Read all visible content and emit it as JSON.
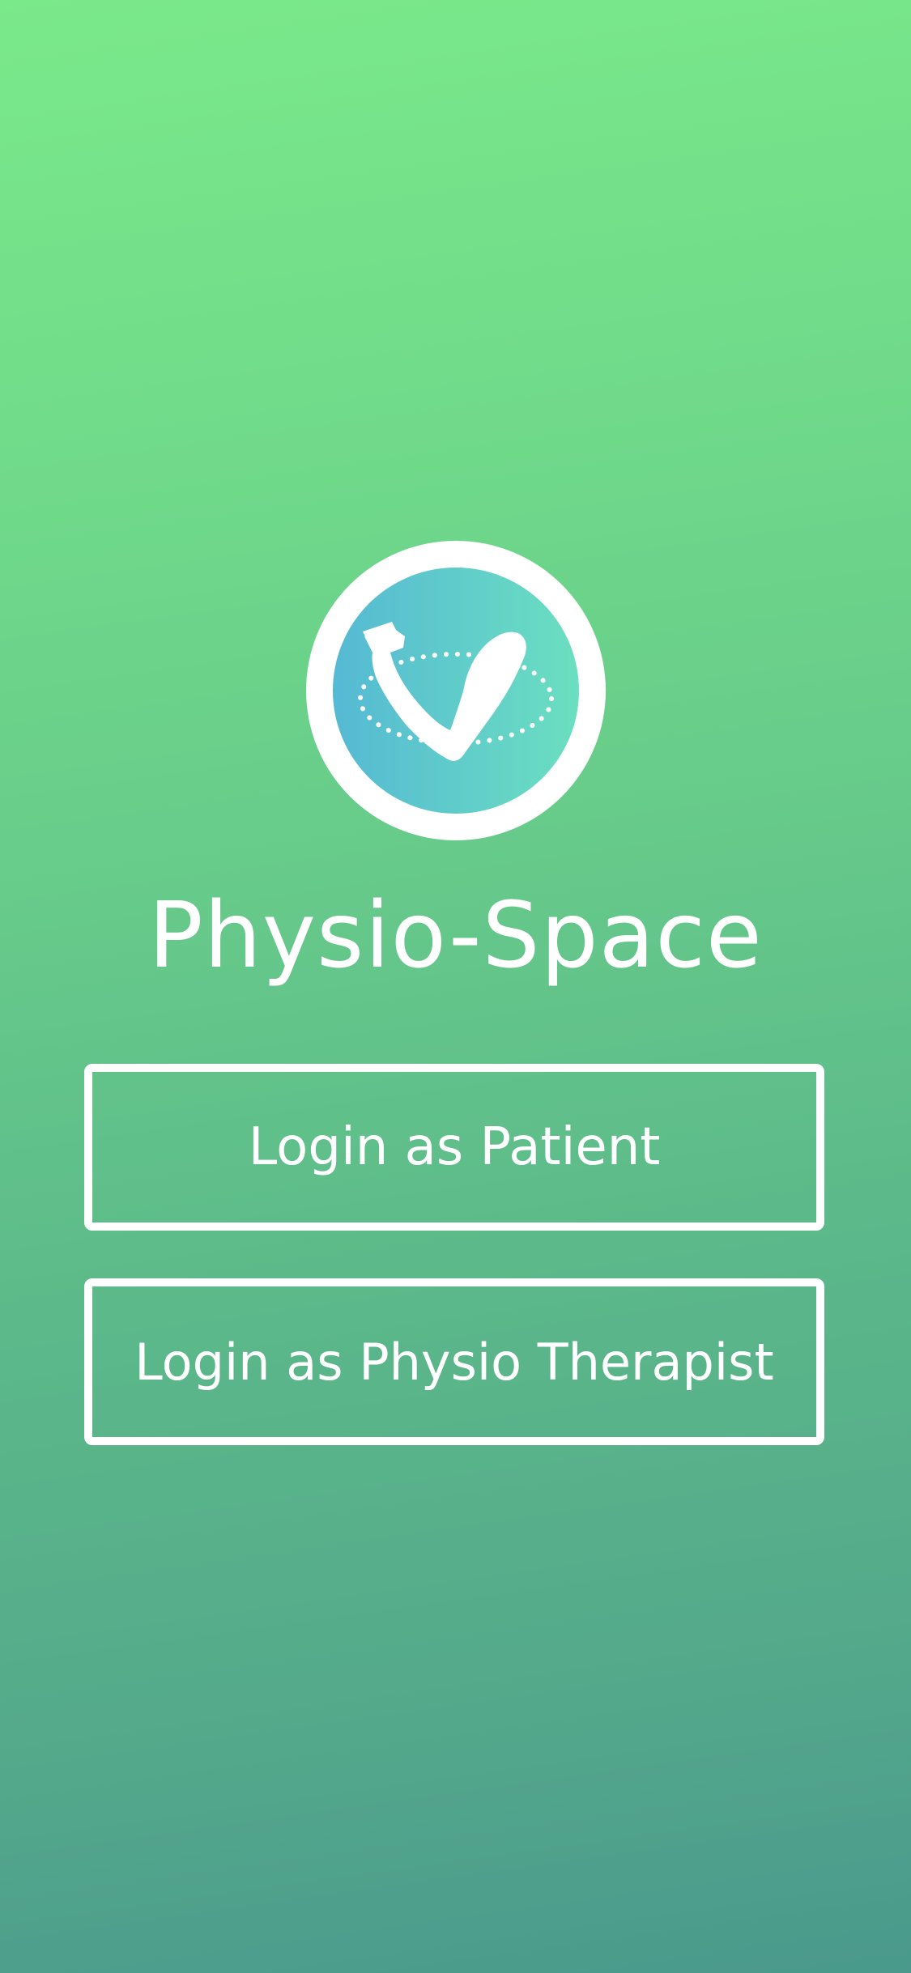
{
  "app": {
    "title": "Physio-Space"
  },
  "logo": {
    "icon": "flexed-arm-icon",
    "ring_color": "#ffffff",
    "gradient_start": "#55b9d4",
    "gradient_end": "#6bdfc0"
  },
  "buttons": {
    "patient_label": "Login as Patient",
    "therapist_label": "Login as Physio Therapist"
  },
  "colors": {
    "background_top": "#7ae98a",
    "background_bottom": "#4a998c",
    "foreground": "#ffffff"
  }
}
